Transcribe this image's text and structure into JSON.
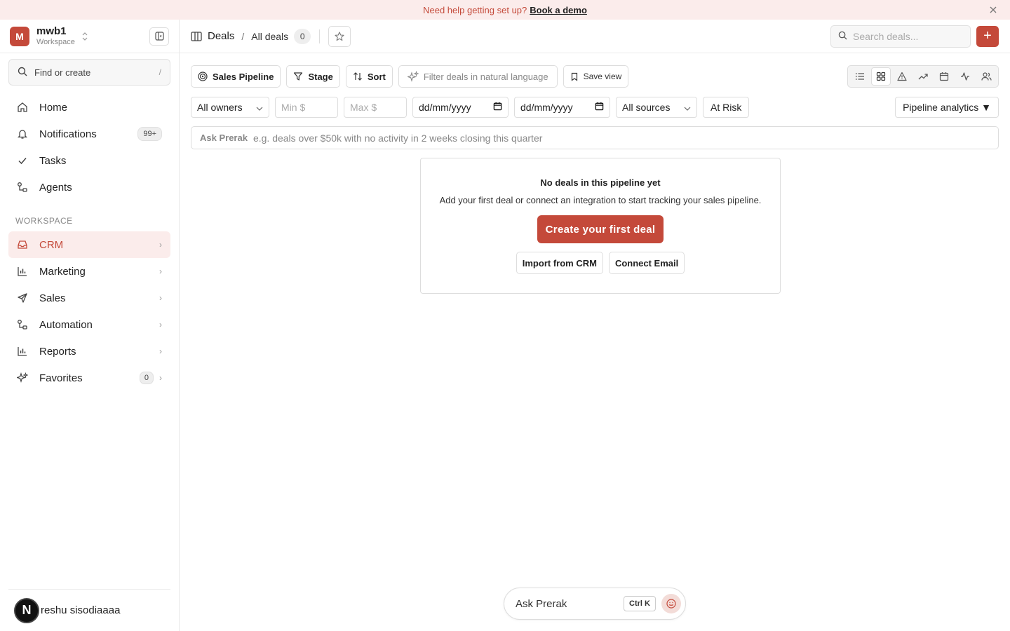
{
  "banner": {
    "text": "Need help getting set up?",
    "link": "Book a demo"
  },
  "workspace": {
    "avatar_letter": "M",
    "name": "mwb1",
    "sub": "Workspace"
  },
  "find": {
    "label": "Find or create",
    "shortcut": "/"
  },
  "nav": {
    "home": "Home",
    "notifications": "Notifications",
    "notifications_badge": "99+",
    "tasks": "Tasks",
    "agents": "Agents"
  },
  "workspace_section": {
    "label": "WORKSPACE",
    "crm": "CRM",
    "marketing": "Marketing",
    "sales": "Sales",
    "automation": "Automation",
    "reports": "Reports",
    "favorites": "Favorites",
    "favorites_count": "0"
  },
  "user": {
    "avatar_letter": "N",
    "name": "reshu sisodiaaaa"
  },
  "topbar": {
    "title": "Deals",
    "separator": "/",
    "current": "All deals",
    "count": "0",
    "search_placeholder": "Search deals...",
    "add_label": "+"
  },
  "toolbar": {
    "pipeline": "Sales Pipeline",
    "stage": "Stage",
    "sort": "Sort",
    "filter_placeholder": "Filter deals in natural language",
    "save_view": "Save view"
  },
  "filters": {
    "owners": "All owners",
    "min_placeholder": "Min $",
    "max_placeholder": "Max $",
    "date_from": "dd/mm/yyyy",
    "date_to": "dd/mm/yyyy",
    "sources": "All sources",
    "at_risk": "At Risk",
    "analytics": "Pipeline analytics ▼"
  },
  "ask": {
    "label": "Ask Prerak",
    "placeholder": "e.g. deals over $50k with no activity in 2 weeks closing this quarter"
  },
  "empty": {
    "title": "No deals in this pipeline yet",
    "description": "Add your first deal or connect an integration to start tracking your sales pipeline.",
    "primary": "Create your first deal",
    "import": "Import from CRM",
    "connect": "Connect Email"
  },
  "ask_pill": {
    "label": "Ask Prerak",
    "shortcut": "Ctrl K"
  },
  "colors": {
    "accent": "#c4493a",
    "accent_light": "#fbeceb"
  }
}
